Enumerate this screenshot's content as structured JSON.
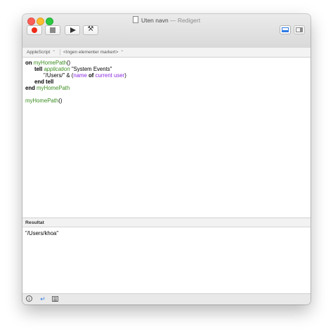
{
  "window": {
    "title": "Uten navn",
    "title_separator": " — ",
    "title_status": "Redigert"
  },
  "toolbar": {
    "buttons": [
      {
        "name": "record-button",
        "icon": "record-icon"
      },
      {
        "name": "stop-button",
        "icon": "stop-icon"
      },
      {
        "name": "run-button",
        "icon": "play-icon"
      },
      {
        "name": "compile-button",
        "icon": "hammer-icon",
        "glyph": "⚒"
      }
    ],
    "view_toggles": [
      "bottom-panel-view-icon",
      "sidebar-view-icon"
    ]
  },
  "navbar": {
    "language": "AppleScript",
    "language_chevron": "⌃",
    "selection": "<Ingen elementer markert>",
    "selection_chevron": "⌃"
  },
  "script": {
    "lines": [
      {
        "indent": "",
        "tokens": [
          {
            "t": "on",
            "c": "kw"
          },
          {
            "t": " ",
            "c": "txt"
          },
          {
            "t": "myHomePath",
            "c": "handler"
          },
          {
            "t": "()",
            "c": "txt"
          }
        ]
      },
      {
        "indent": "      ",
        "tokens": [
          {
            "t": "tell",
            "c": "kw"
          },
          {
            "t": " ",
            "c": "txt"
          },
          {
            "t": "application",
            "c": "app"
          },
          {
            "t": " \"System Events\"",
            "c": "txt"
          }
        ]
      },
      {
        "indent": "            ",
        "tokens": [
          {
            "t": "\"/Users/\" & (",
            "c": "txt"
          },
          {
            "t": "name",
            "c": "prop"
          },
          {
            "t": " ",
            "c": "txt"
          },
          {
            "t": "of",
            "c": "kw"
          },
          {
            "t": " ",
            "c": "txt"
          },
          {
            "t": "current user",
            "c": "prop"
          },
          {
            "t": ")",
            "c": "txt"
          }
        ]
      },
      {
        "indent": "      ",
        "tokens": [
          {
            "t": "end",
            "c": "kw"
          },
          {
            "t": " ",
            "c": "txt"
          },
          {
            "t": "tell",
            "c": "kw"
          }
        ]
      },
      {
        "indent": "",
        "tokens": [
          {
            "t": "end",
            "c": "kw"
          },
          {
            "t": " ",
            "c": "txt"
          },
          {
            "t": "myHomePath",
            "c": "handler"
          }
        ]
      },
      {
        "indent": "",
        "tokens": []
      },
      {
        "indent": "",
        "tokens": [
          {
            "t": "myHomePath",
            "c": "handler"
          },
          {
            "t": "()",
            "c": "txt"
          }
        ]
      }
    ]
  },
  "result": {
    "header": "Resultat",
    "value": "\"/Users/khoa\""
  },
  "bottombar": {
    "info_icon": "ⓘ",
    "return_icon": "↵"
  },
  "colors": {
    "close": "#fc5f57",
    "minimize": "#fdbc2e",
    "maximize": "#2ac940",
    "record": "#ee2a16",
    "handler_green": "#3a8d1f",
    "property_purple": "#8a2be2",
    "accent_blue": "#2f7ae5"
  }
}
